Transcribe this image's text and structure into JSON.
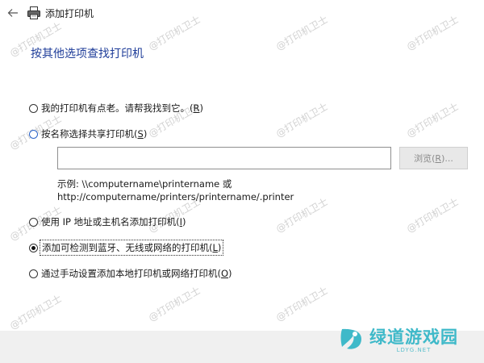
{
  "window": {
    "title": "添加打印机"
  },
  "page": {
    "heading": "按其他选项查找打印机"
  },
  "options": [
    {
      "text": "我的打印机有点老。请帮我找到它。(",
      "key": "R",
      "suffix": ")",
      "selected": false
    },
    {
      "text": "按名称选择共享打印机(",
      "key": "S",
      "suffix": ")",
      "selected": false
    },
    {
      "text": "使用 IP 地址或主机名添加打印机(",
      "key": "I",
      "suffix": ")",
      "selected": false
    },
    {
      "text": "添加可检测到蓝牙、无线或网络的打印机(",
      "key": "L",
      "suffix": ")",
      "selected": true
    },
    {
      "text": "通过手动设置添加本地打印机或网络打印机(",
      "key": "O",
      "suffix": ")",
      "selected": false
    }
  ],
  "share": {
    "value": "",
    "browse_prefix": "浏览(",
    "browse_key": "R",
    "browse_suffix": ")...",
    "example_line1": "示例: \\\\computername\\printername 或",
    "example_line2": "http://computername/printers/printername/.printer"
  },
  "watermark": {
    "text": "@打印机卫士"
  },
  "brand": {
    "name": "绿道游戏园",
    "site": "LDYG.NET",
    "color": "#3fb9c9"
  },
  "icons": {
    "back": "back-arrow-icon",
    "printer": "printer-icon",
    "brand": "brand-logo-icon"
  }
}
